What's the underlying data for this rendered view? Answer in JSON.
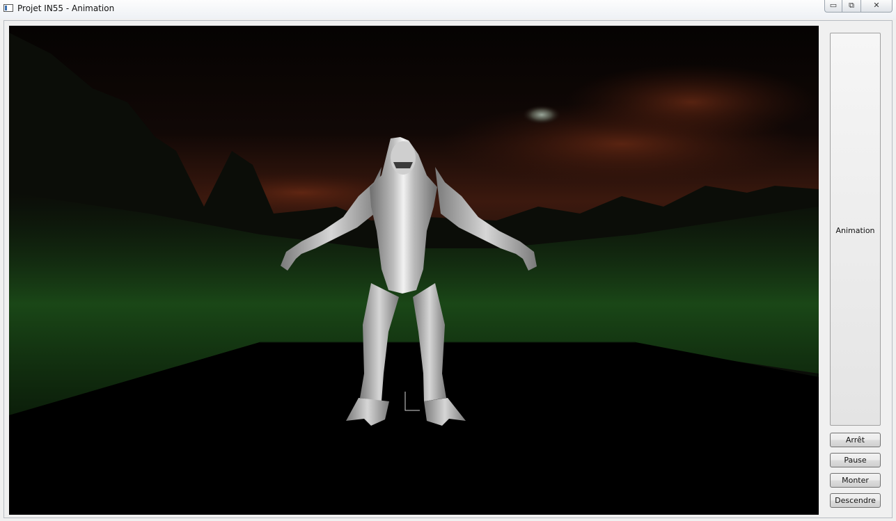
{
  "window": {
    "title": "Projet IN55 - Animation",
    "controls": {
      "minimize": "▭",
      "maximize": "⧉",
      "close": "✕"
    }
  },
  "sidebar": {
    "panel_label": "Animation",
    "buttons": [
      "Arrêt",
      "Pause",
      "Monter",
      "Descendre"
    ]
  },
  "colors": {
    "sky": "#1a0c08",
    "horizon": "#5a2414",
    "fog": "#1e4f1c",
    "model": "#c4c4c4"
  }
}
